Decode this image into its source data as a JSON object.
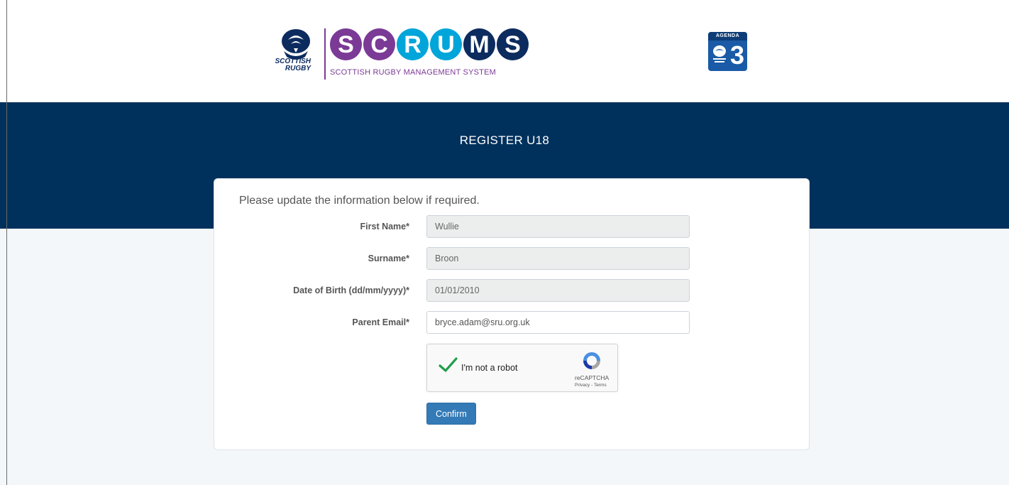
{
  "header": {
    "org_logo": {
      "icon": "thistle-crest-icon",
      "text_line1": "SCOTTISH",
      "text_line2": "RUGBY"
    },
    "app_logo": {
      "letters": [
        {
          "char": "S",
          "color": "#7b3a96"
        },
        {
          "char": "C",
          "color": "#7b3a96"
        },
        {
          "char": "R",
          "color": "#00a5d9"
        },
        {
          "char": "U",
          "color": "#00a5d9"
        },
        {
          "char": "M",
          "color": "#0c2b5e"
        },
        {
          "char": "S",
          "color": "#0c2b5e"
        }
      ],
      "subtitle": "SCOTTISH RUGBY MANAGEMENT SYSTEM"
    },
    "agenda_badge": {
      "label": "AGENDA",
      "number": "3"
    }
  },
  "banner": {
    "title": "REGISTER U18"
  },
  "form": {
    "intro": "Please update the information below if required.",
    "fields": [
      {
        "label": "First Name*",
        "value": "Wullie",
        "readonly": true
      },
      {
        "label": "Surname*",
        "value": "Broon",
        "readonly": true
      },
      {
        "label": "Date of Birth (dd/mm/yyyy)*",
        "value": "01/01/2010",
        "readonly": true
      },
      {
        "label": "Parent Email*",
        "value": "bryce.adam@sru.org.uk",
        "readonly": false
      }
    ],
    "recaptcha": {
      "label": "I'm not a robot",
      "brand": "reCAPTCHA",
      "terms": "Privacy - Terms",
      "checked": true
    },
    "confirm_label": "Confirm"
  },
  "colors": {
    "banner": "#00315c",
    "page_bg": "#f4f7fa",
    "button": "#337ab7",
    "brand_purple": "#7b3a96",
    "brand_cyan": "#00a5d9",
    "brand_navy": "#0c2b5e",
    "check_green": "#1e9e4a"
  }
}
